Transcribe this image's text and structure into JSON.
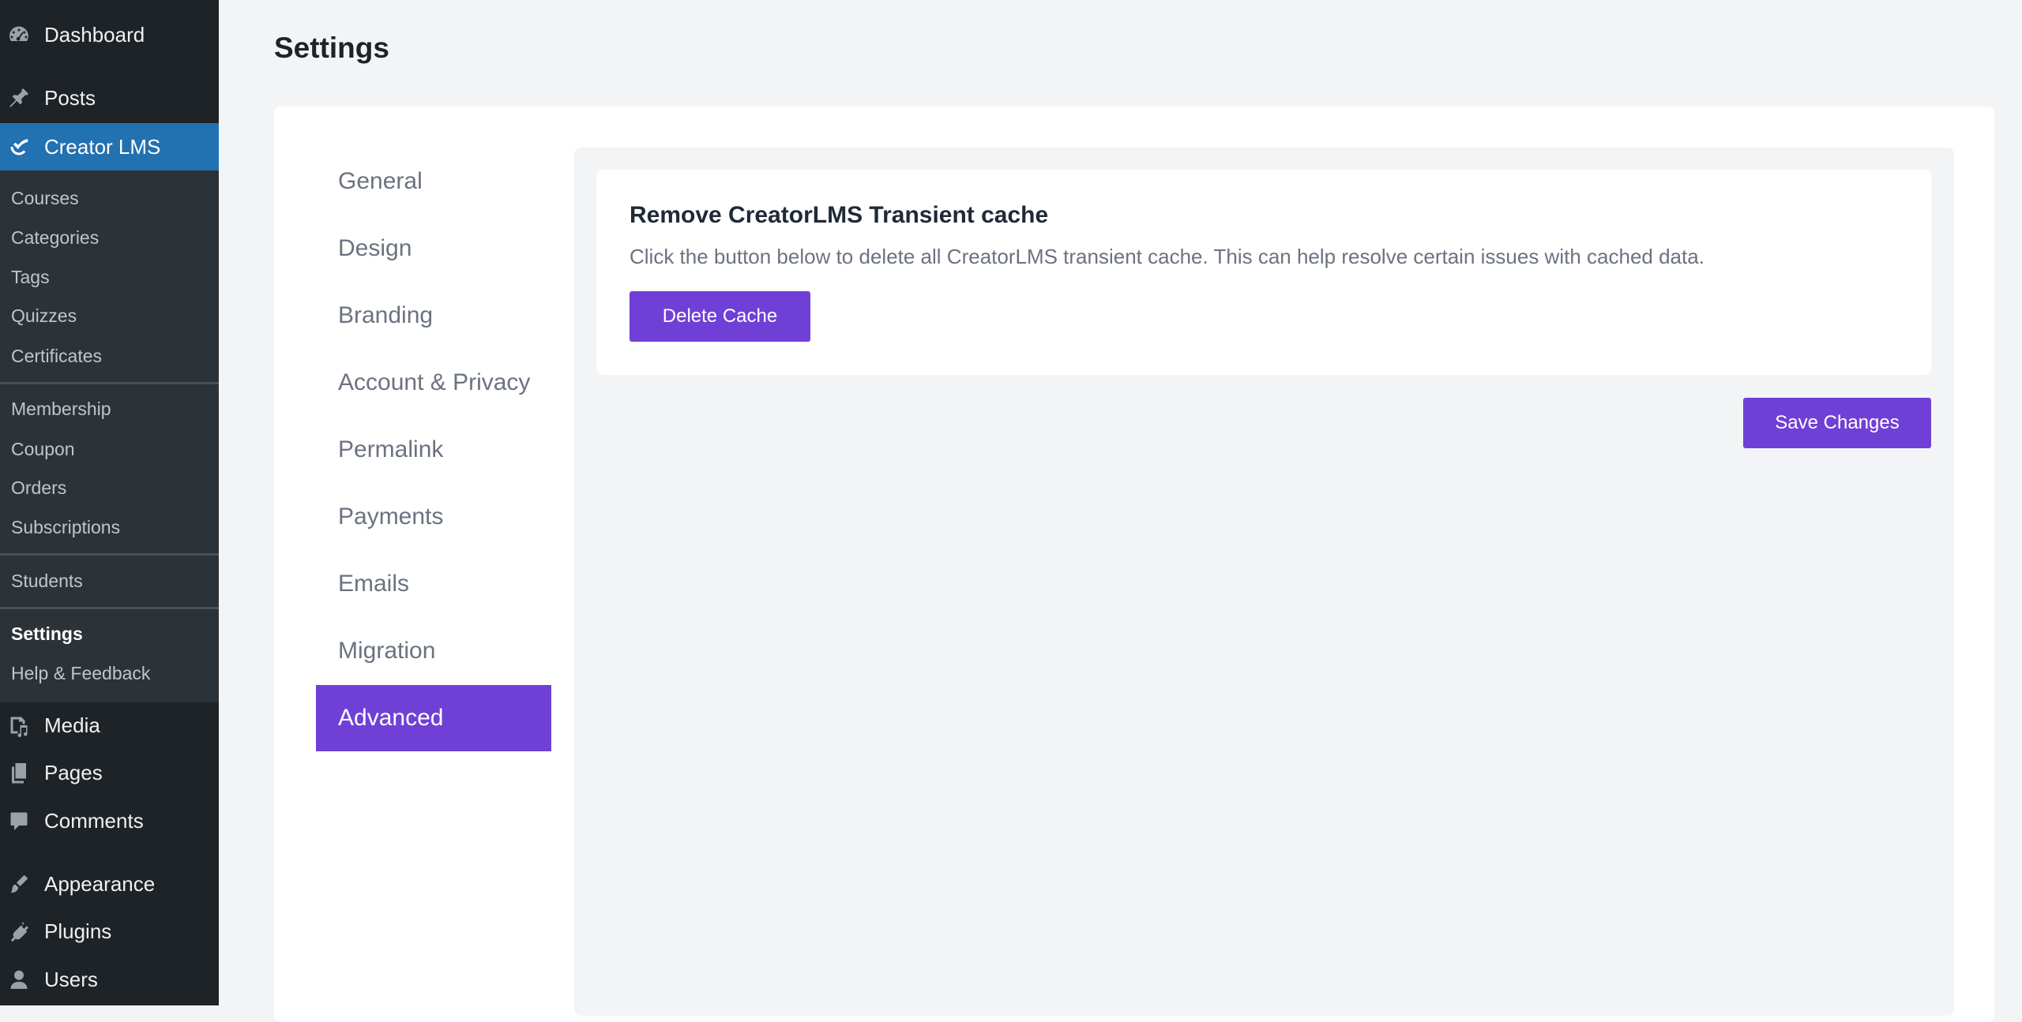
{
  "sidebar": {
    "top_items": [
      {
        "label": "Dashboard",
        "icon": "dashboard-icon"
      },
      {
        "label": "Posts",
        "icon": "pin-icon"
      },
      {
        "label": "Creator LMS",
        "icon": "creator-lms-icon"
      }
    ],
    "submenu": [
      {
        "label": "Courses"
      },
      {
        "label": "Categories"
      },
      {
        "label": "Tags"
      },
      {
        "label": "Quizzes"
      },
      {
        "label": "Certificates"
      },
      {
        "label": "Membership"
      },
      {
        "label": "Coupon"
      },
      {
        "label": "Orders"
      },
      {
        "label": "Subscriptions"
      },
      {
        "label": "Students"
      },
      {
        "label": "Settings"
      },
      {
        "label": "Help & Feedback"
      }
    ],
    "bottom_items": [
      {
        "label": "Media",
        "icon": "media-icon"
      },
      {
        "label": "Pages",
        "icon": "pages-icon"
      },
      {
        "label": "Comments",
        "icon": "comment-icon"
      },
      {
        "label": "Appearance",
        "icon": "brush-icon"
      },
      {
        "label": "Plugins",
        "icon": "plugin-icon"
      },
      {
        "label": "Users",
        "icon": "user-icon"
      }
    ],
    "current_top": "Creator LMS",
    "current_sub": "Settings"
  },
  "main": {
    "title": "Settings",
    "tabs": [
      {
        "label": "General"
      },
      {
        "label": "Design"
      },
      {
        "label": "Branding"
      },
      {
        "label": "Account & Privacy"
      },
      {
        "label": "Permalink"
      },
      {
        "label": "Payments"
      },
      {
        "label": "Emails"
      },
      {
        "label": "Migration"
      },
      {
        "label": "Advanced"
      }
    ],
    "active_tab": "Advanced",
    "cache": {
      "title": "Remove CreatorLMS Transient cache",
      "description": "Click the button below to delete all CreatorLMS transient cache. This can help resolve certain issues with cached data.",
      "button_label": "Delete Cache"
    },
    "save_label": "Save Changes"
  },
  "colors": {
    "sidebar_bg": "#1d2327",
    "submenu_bg": "#2c3338",
    "current_menu": "#2271b1",
    "accent": "#7040d6",
    "page_bg": "#f3f4f6"
  }
}
